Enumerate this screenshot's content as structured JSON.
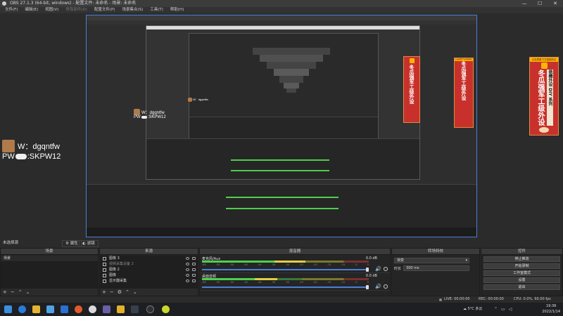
{
  "window": {
    "title": "OBS 27.1.3 (64-bit, windows) - 配置文件: 未命名 - 场景: 未命名",
    "controls": [
      "—",
      "☐",
      "✕"
    ]
  },
  "menu": [
    "文件(F)",
    "编辑(E)",
    "视图(V)",
    "停靠部件(D)",
    "配置文件(P)",
    "场景集合(S)",
    "工具(T)",
    "帮助(H)"
  ],
  "watermark": {
    "line1": "W：dgqntfw",
    "line2_prefix": "PW",
    "line2_suffix": ":SKPW12"
  },
  "banner": {
    "top": "点击屏幕下方链接购买",
    "brand": "冬瓜强军工级外设",
    "sub": "装機外设 DIY 系列"
  },
  "docks": {
    "scenes_title": "场景",
    "sources_title": "来源",
    "mixer_title": "混音器",
    "transitions_title": "转场特效",
    "controls_title": "控件",
    "no_source_label": "未选择源",
    "props_btn": "属性",
    "filters_btn": "滤镜",
    "scenes": [
      "场景"
    ],
    "sources": [
      "图像 3",
      "视频采集设备 2",
      "图像 2",
      "图像",
      "显示器采集"
    ],
    "mixer": [
      {
        "name": "麦克风/Aux",
        "db": "0.0 dB",
        "level": 0.62,
        "volume": 0.86
      },
      {
        "name": "桌面音频",
        "db": "0.0 dB",
        "level": 0.45,
        "volume": 0.86
      }
    ],
    "meter_ticks": [
      "-60",
      "-55",
      "-50",
      "-45",
      "-40",
      "-35",
      "-30",
      "-25",
      "-20",
      "-15",
      "-10",
      "-5",
      "0"
    ],
    "transition_select": "渐变",
    "duration_label": "时长",
    "duration_value": "300 ms",
    "controls": [
      "停止推流",
      "开始录制",
      "工作室模式",
      "设置",
      "退出"
    ]
  },
  "status": {
    "live": "LIVE: 00:00:00",
    "rec": "REC: 00:00:00",
    "cpu": "CPU: 0.0%, 60.00 fps"
  },
  "taskbar": {
    "weather": "5°C 多云",
    "time": "19:36",
    "date": "2022/1/14"
  },
  "colors": {
    "accent": "#4a7fd6",
    "banner_red": "#c8312b",
    "banner_gold": "#ffb400"
  }
}
